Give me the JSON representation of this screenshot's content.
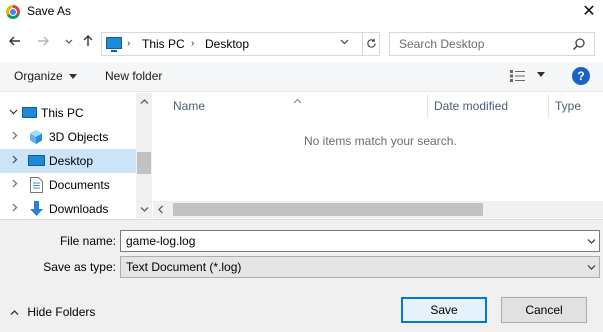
{
  "window": {
    "title": "Save As",
    "close_glyph": "✕"
  },
  "nav": {
    "back_icon": "arrow-left-icon",
    "forward_icon": "arrow-right-icon",
    "recent_icon": "chevron-down-icon",
    "up_icon": "arrow-up-icon",
    "breadcrumb": [
      "This PC",
      "Desktop"
    ],
    "search_placeholder": "Search Desktop"
  },
  "toolbar": {
    "organize_label": "Organize",
    "new_folder_label": "New folder",
    "help_label": "?"
  },
  "tree": {
    "items": [
      {
        "label": "This PC",
        "icon": "computer-icon",
        "expanded": true
      },
      {
        "label": "3D Objects",
        "icon": "3d-objects-icon"
      },
      {
        "label": "Desktop",
        "icon": "desktop-icon",
        "selected": true
      },
      {
        "label": "Documents",
        "icon": "documents-icon"
      },
      {
        "label": "Downloads",
        "icon": "downloads-icon"
      }
    ]
  },
  "filelist": {
    "columns": [
      "Name",
      "Date modified",
      "Type"
    ],
    "empty_message": "No items match your search."
  },
  "form": {
    "filename_label": "File name:",
    "filename_value": "game-log.log",
    "type_label": "Save as type:",
    "type_value": "Text Document (*.log)"
  },
  "footer": {
    "hide_folders_label": "Hide Folders",
    "save_label": "Save",
    "cancel_label": "Cancel"
  },
  "colors": {
    "selection": "#cce4f7",
    "accent": "#0078d7",
    "help": "#1a63c4"
  }
}
